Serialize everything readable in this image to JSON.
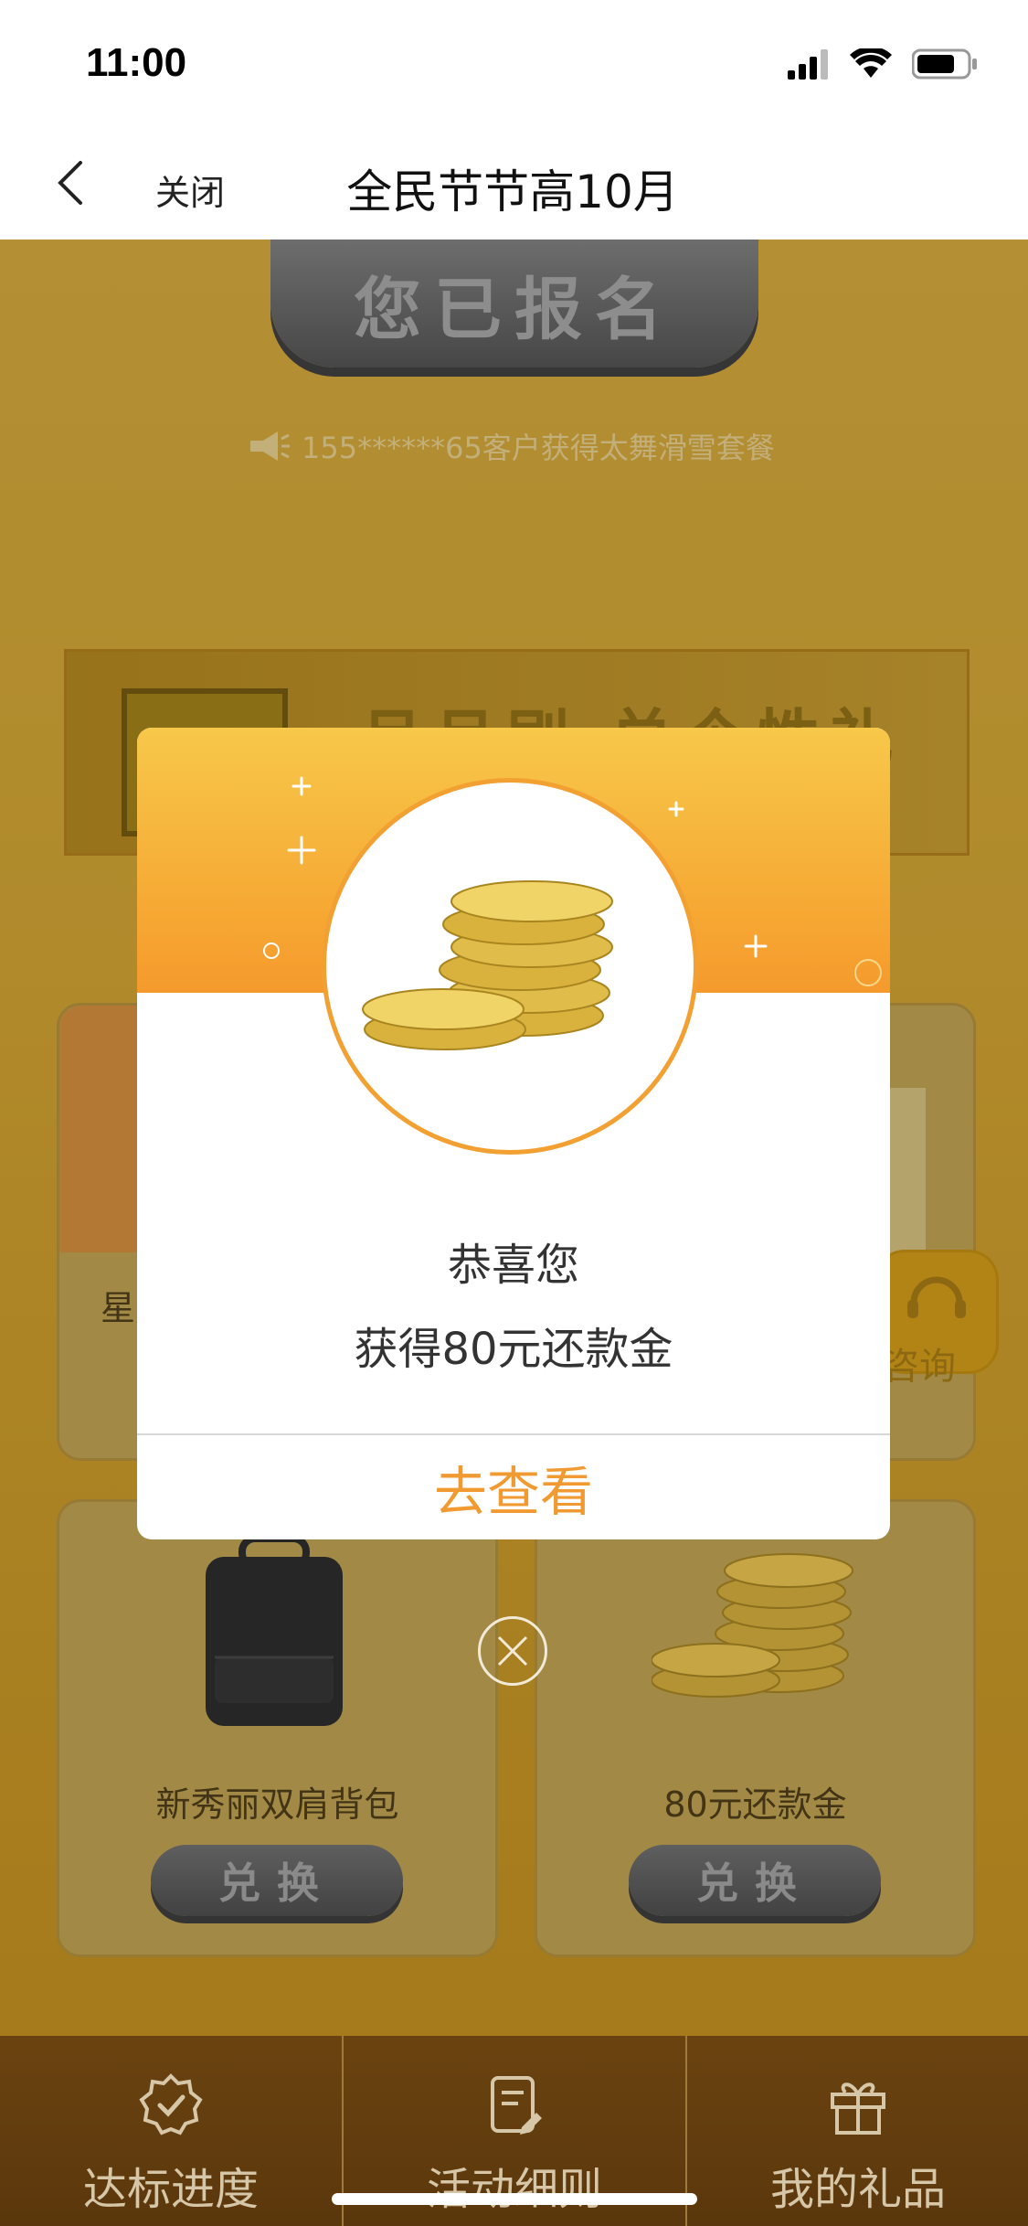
{
  "status_bar": {
    "time": "11:00"
  },
  "nav": {
    "close_label": "关闭",
    "title": "全民节节高10月"
  },
  "background": {
    "signed_button": "您已报名",
    "ticker": "155******65客户获得太舞滑雪套餐",
    "banner_text": "月月刷 兑个性礼",
    "cards": [
      {
        "name": "星",
        "button": ""
      },
      {
        "name": "",
        "button": ""
      },
      {
        "name": "新秀丽双肩背包",
        "button": "兑换"
      },
      {
        "name": "80元还款金",
        "button": "兑换"
      }
    ],
    "consult_label": "咨询"
  },
  "modal": {
    "line1": "恭喜您",
    "line2": "获得80元还款金",
    "action": "去查看"
  },
  "tabbar": {
    "tabs": [
      {
        "label": "达标进度",
        "icon": "badge-check-icon"
      },
      {
        "label": "活动细则",
        "icon": "document-edit-icon"
      },
      {
        "label": "我的礼品",
        "icon": "gift-icon"
      }
    ]
  },
  "colors": {
    "accent": "#f19a31",
    "page_gold": "#c79a2f",
    "tabbar_brown": "#5a370c"
  }
}
